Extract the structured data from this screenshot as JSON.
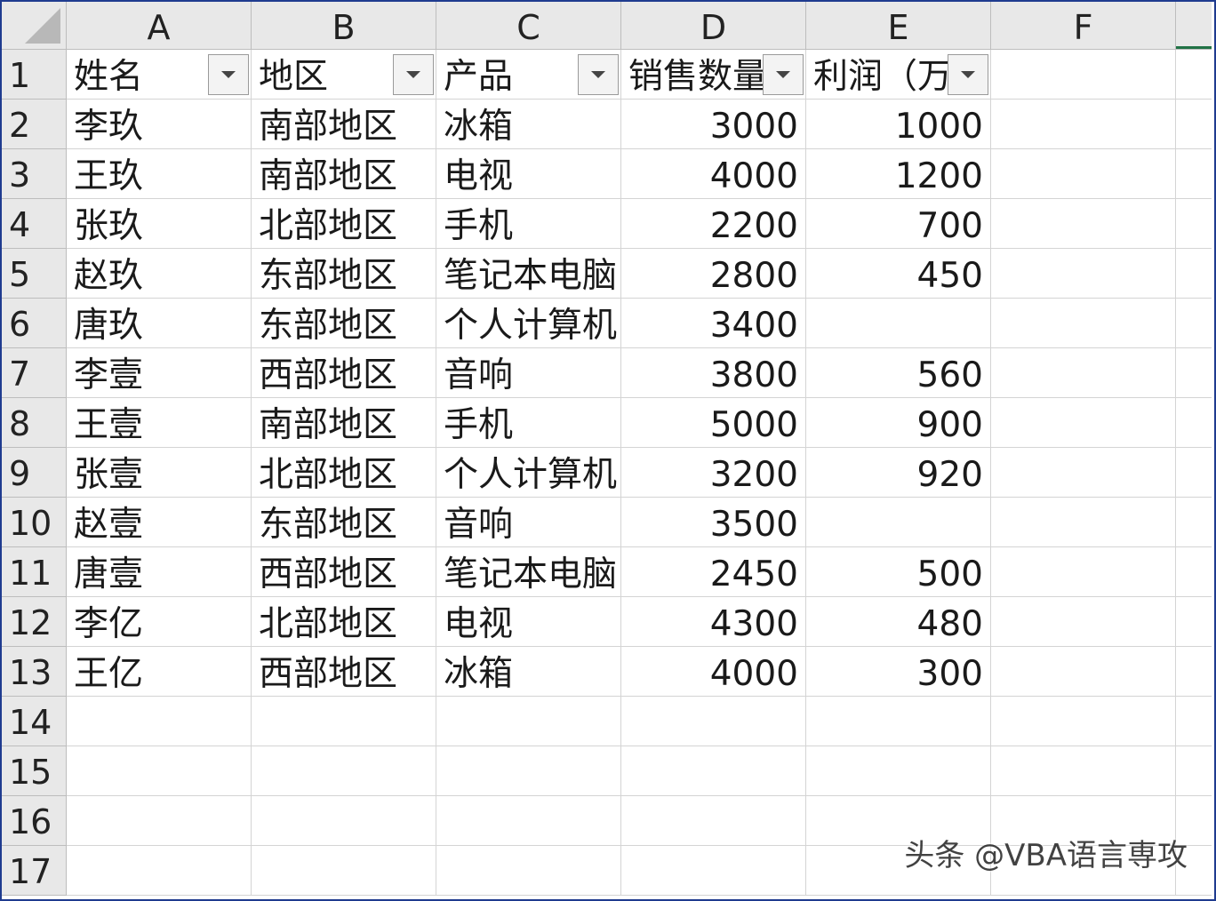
{
  "columns": [
    "A",
    "B",
    "C",
    "D",
    "E",
    "F"
  ],
  "row_numbers": [
    "1",
    "2",
    "3",
    "4",
    "5",
    "6",
    "7",
    "8",
    "9",
    "10",
    "11",
    "12",
    "13",
    "14",
    "15",
    "16",
    "17"
  ],
  "header_row": [
    {
      "text": "姓名",
      "align": "left"
    },
    {
      "text": "地区",
      "align": "left"
    },
    {
      "text": "产品",
      "align": "left"
    },
    {
      "text": "销售数量",
      "align": "left"
    },
    {
      "text": "利润（万",
      "align": "left"
    }
  ],
  "rows": [
    [
      "李玖",
      "南部地区",
      "冰箱",
      "3000",
      "1000"
    ],
    [
      "王玖",
      "南部地区",
      "电视",
      "4000",
      "1200"
    ],
    [
      "张玖",
      "北部地区",
      "手机",
      "2200",
      "700"
    ],
    [
      "赵玖",
      "东部地区",
      "笔记本电脑",
      "2800",
      "450"
    ],
    [
      "唐玖",
      "东部地区",
      "个人计算机",
      "3400",
      ""
    ],
    [
      "李壹",
      "西部地区",
      "音响",
      "3800",
      "560"
    ],
    [
      "王壹",
      "南部地区",
      "手机",
      "5000",
      "900"
    ],
    [
      "张壹",
      "北部地区",
      "个人计算机",
      "3200",
      "920"
    ],
    [
      "赵壹",
      "东部地区",
      "音响",
      "3500",
      ""
    ],
    [
      "唐壹",
      "西部地区",
      "笔记本电脑",
      "2450",
      "500"
    ],
    [
      "李亿",
      "北部地区",
      "电视",
      "4300",
      "480"
    ],
    [
      "王亿",
      "西部地区",
      "冰箱",
      "4000",
      "300"
    ]
  ],
  "filter_icon": "dropdown-arrow-icon",
  "watermark": "头条 @VBA语言専攻",
  "colors": {
    "header_bg": "#e8e8e8",
    "gridline": "#d4d4d4",
    "selection": "#217346",
    "border": "#1f3b8f"
  }
}
